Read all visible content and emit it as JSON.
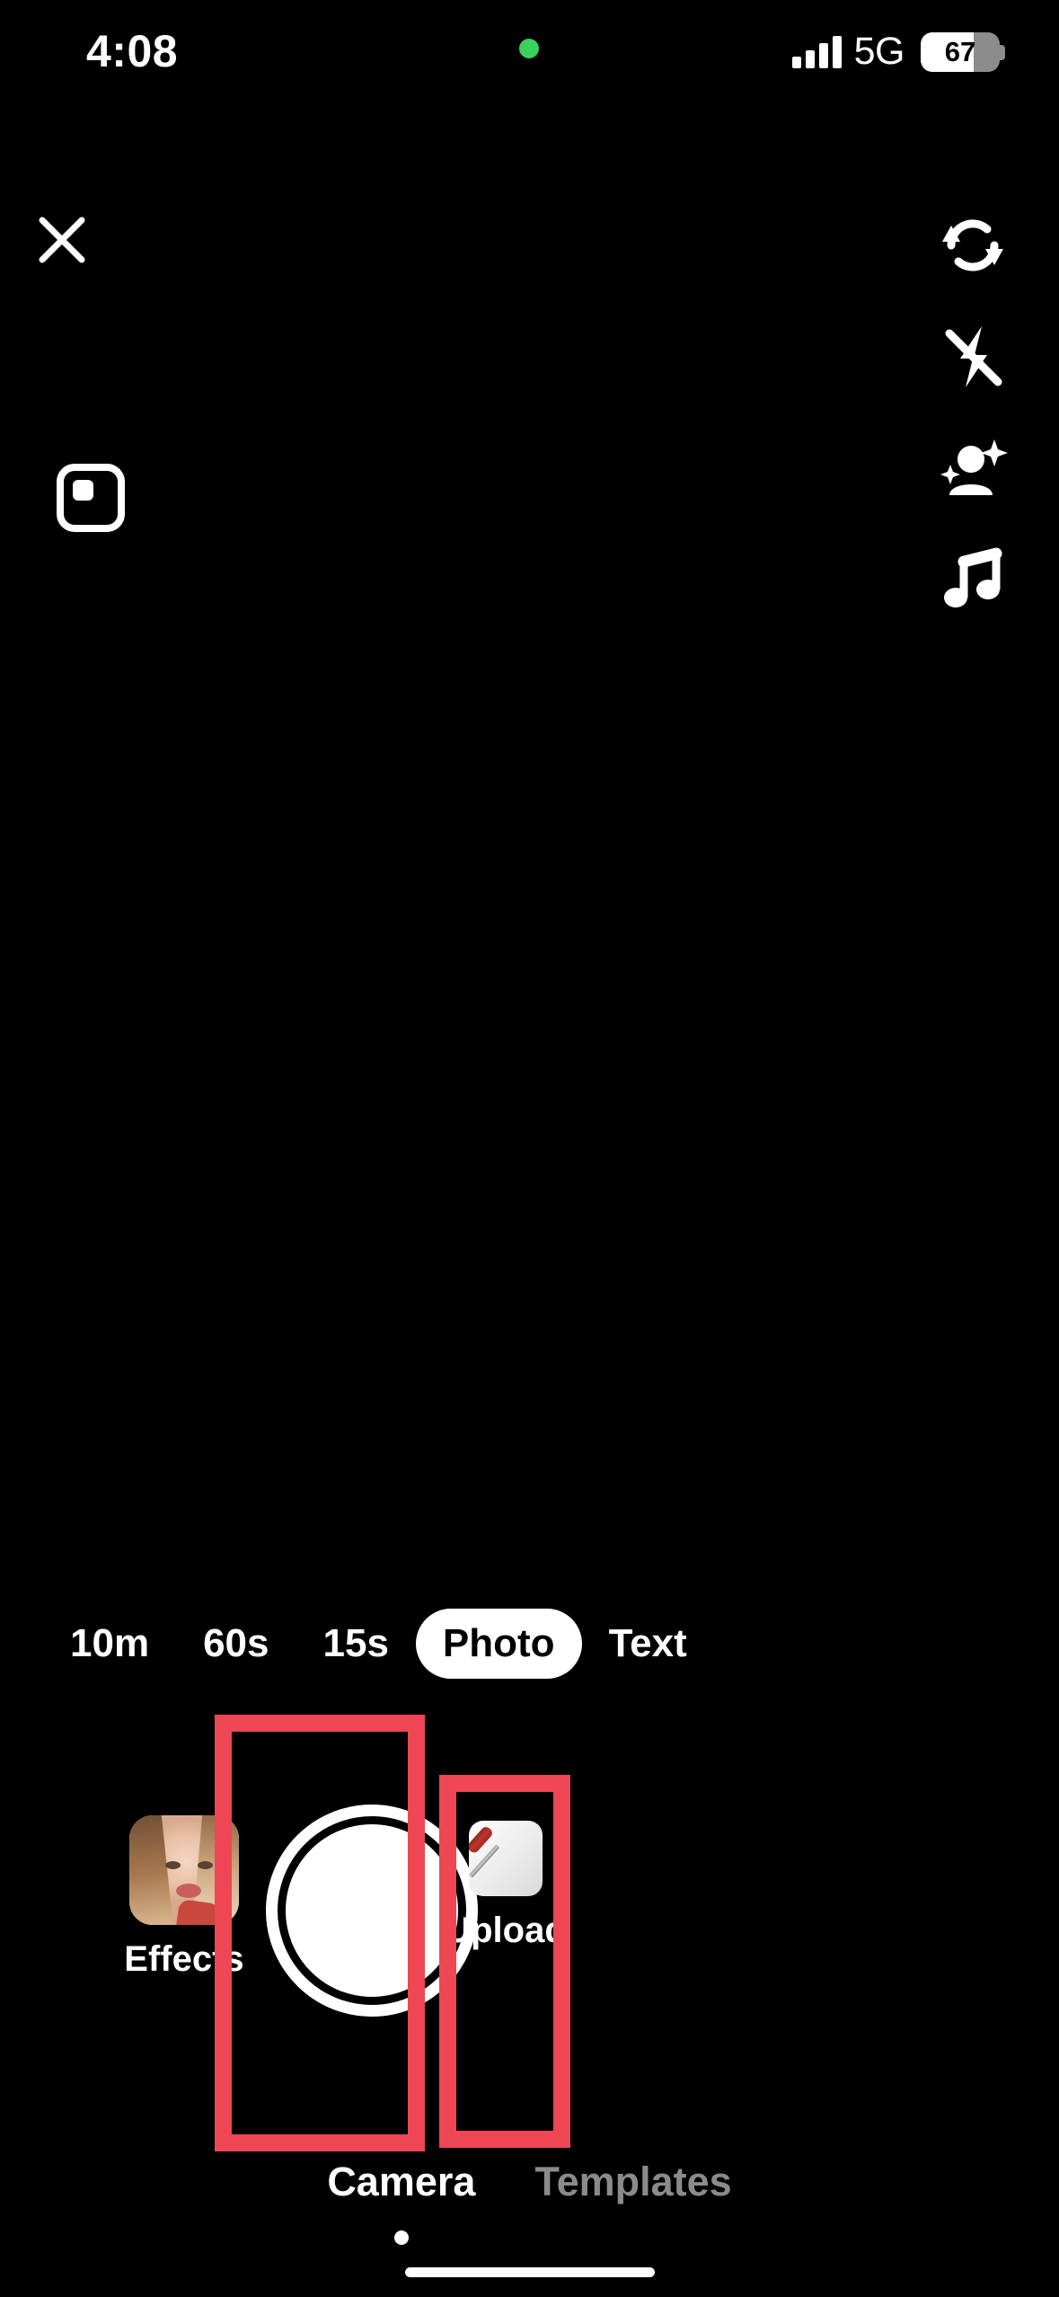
{
  "status_bar": {
    "time": "4:08",
    "recording_indicator": "green-dot",
    "network": "5G",
    "battery_percent": "67",
    "signal_icon": "cellular-signal-icon"
  },
  "viewport": {
    "close_label": "×",
    "close_icon": "close-icon",
    "aspect_ratio_icon": "picture-in-picture-icon"
  },
  "tools": [
    {
      "name": "flip-camera",
      "icon": "flip-camera-icon",
      "label": "Flip"
    },
    {
      "name": "flash",
      "icon": "flash-off-icon",
      "label": "Flash off"
    },
    {
      "name": "enhance",
      "icon": "beauty-enhance-icon",
      "label": "Enhance"
    },
    {
      "name": "sounds",
      "icon": "music-note-icon",
      "label": "Add sound"
    }
  ],
  "modes": [
    {
      "label": "10m",
      "selected": false
    },
    {
      "label": "60s",
      "selected": false
    },
    {
      "label": "15s",
      "selected": false
    },
    {
      "label": "Photo",
      "selected": true
    },
    {
      "label": "Text",
      "selected": false
    }
  ],
  "controls": {
    "effects_label": "Effects",
    "effects_thumb_icon": "face-effect-thumbnail",
    "shutter_icon": "shutter-button",
    "upload_label": "Upload",
    "upload_thumb_icon": "screwdriver-photo-thumbnail"
  },
  "annotations": {
    "color": "#ee4655",
    "boxes": [
      {
        "target": "shutter-button"
      },
      {
        "target": "upload-button"
      }
    ]
  },
  "bottom_tabs": [
    {
      "label": "Camera",
      "active": true
    },
    {
      "label": "Templates",
      "active": false
    }
  ],
  "colors": {
    "background": "#000000",
    "accent_red": "#ee4655",
    "active_text": "#ffffff",
    "inactive_text": "#8b8b8b",
    "recording_dot": "#3ad15c"
  }
}
